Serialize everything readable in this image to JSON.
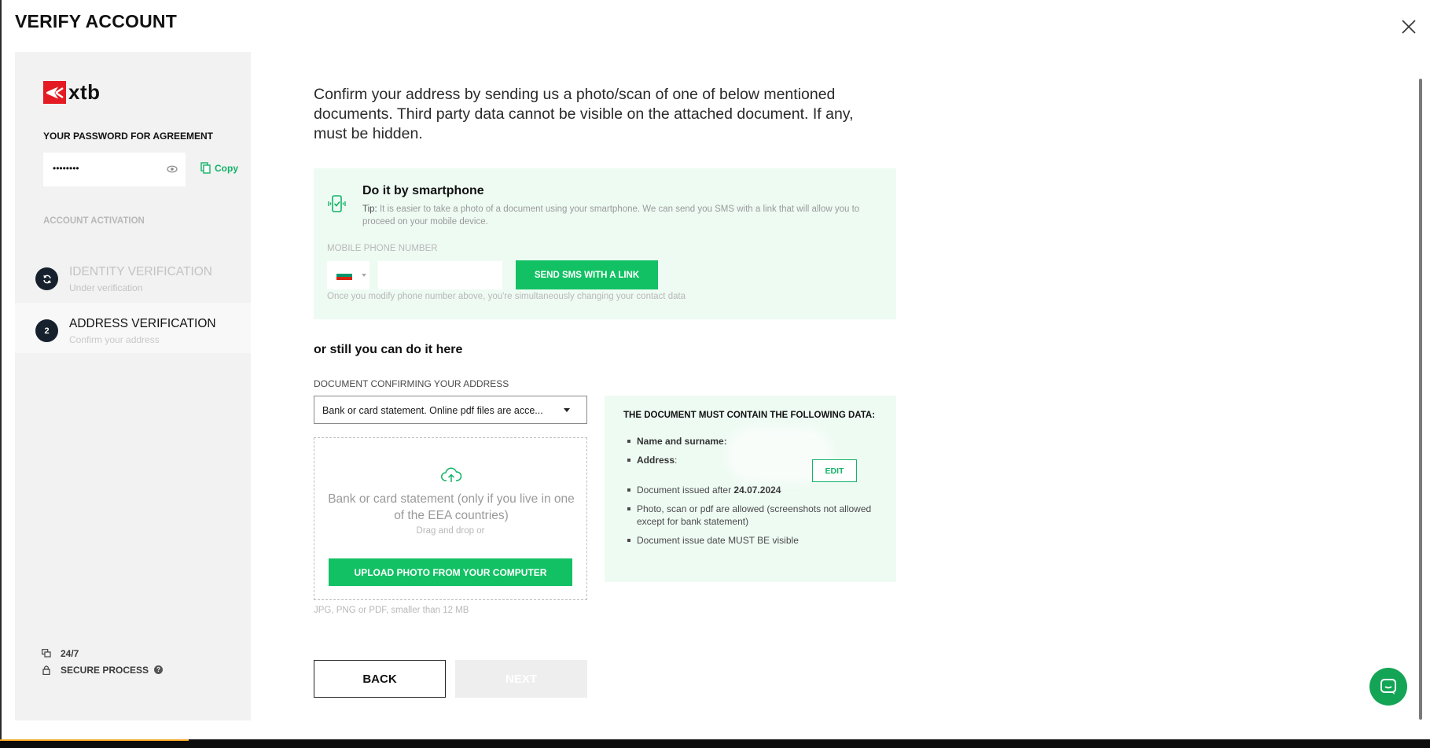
{
  "header": {
    "title": "VERIFY ACCOUNT"
  },
  "sidebar": {
    "logo_text": "xtb",
    "password_label": "YOUR PASSWORD FOR AGREEMENT",
    "password_value": "••••••••",
    "copy_label": "Copy",
    "section_label": "ACCOUNT ACTIVATION",
    "steps": [
      {
        "badge": "",
        "title": "IDENTITY VERIFICATION",
        "subtitle": "Under verification",
        "state": "done"
      },
      {
        "badge": "2",
        "title": "ADDRESS VERIFICATION",
        "subtitle": "Confirm your address",
        "state": "active"
      }
    ],
    "support": {
      "hours": "24/7",
      "secure": "SECURE PROCESS"
    }
  },
  "main": {
    "intro": "Confirm your address by sending us a photo/scan of one of below mentioned documents. Third party data cannot be visible on the attached document. If any, must be hidden.",
    "smartphone": {
      "title": "Do it by smartphone",
      "tip_label": "Tip:",
      "tip_text": "It is easier to take a photo of a document using your smartphone. We can send you SMS with a link that will allow you to proceed on your mobile device.",
      "phone_label": "MOBILE PHONE NUMBER",
      "phone_value": "",
      "country_flag_colors": [
        "#ffffff",
        "#00966e",
        "#d62612"
      ],
      "send_button": "SEND SMS WITH A LINK",
      "note": "Once you modify phone number above, you're simultaneously changing your contact data"
    },
    "alternative_title": "or still you can do it here",
    "document": {
      "label": "DOCUMENT CONFIRMING YOUR ADDRESS",
      "selected": "Bank or card statement. Online pdf files are acce..."
    },
    "upload": {
      "title": "Bank or card statement (only if you live in one of the EEA countries)",
      "subtitle": "Drag and drop or",
      "button": "UPLOAD PHOTO FROM YOUR COMPUTER",
      "file_note": "JPG, PNG or PDF, smaller than 12 MB"
    },
    "requirements": {
      "title": "THE DOCUMENT MUST CONTAIN THE FOLLOWING DATA:",
      "name_label": "Name and surname:",
      "address_label": "Address",
      "edit_button": "EDIT",
      "issued_text": "Document issued after",
      "issued_date": "24.07.2024",
      "formats_text": "Photo, scan or pdf are allowed (screenshots not allowed except for bank statement)",
      "date_visible_text": "Document issue date MUST BE visible"
    },
    "buttons": {
      "back": "BACK",
      "next": "NEXT"
    }
  },
  "colors": {
    "accent": "#13c165",
    "brand": "#e41b23",
    "panel": "#eefbf3",
    "dark": "#16212d"
  }
}
